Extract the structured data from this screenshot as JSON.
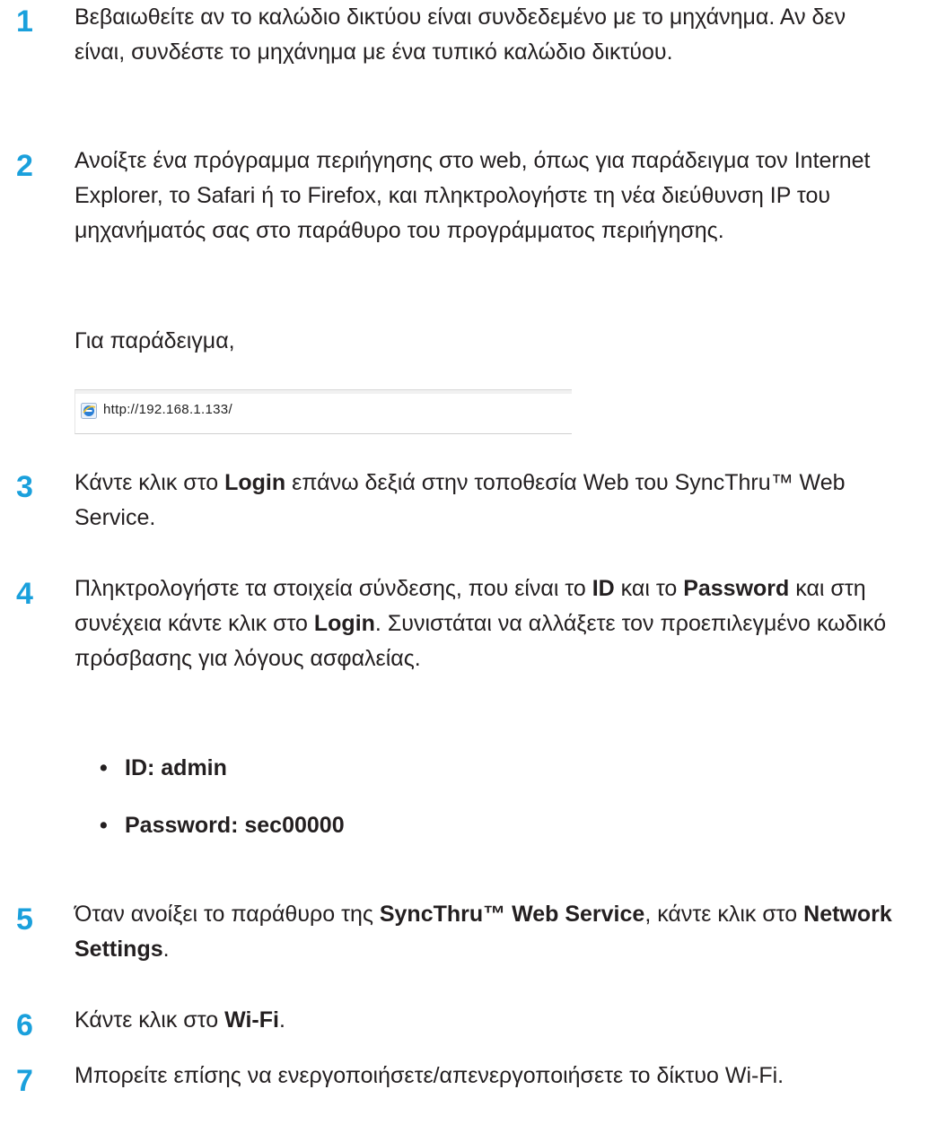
{
  "steps": [
    {
      "num": "1",
      "parts": [
        {
          "t": "Βεβαιωθείτε αν το καλώδιο δικτύου είναι συνδεδεμένο με το μηχάνημα. Αν δεν είναι, συνδέστε το μηχάνημα με ένα τυπικό καλώδιο δικτύου."
        }
      ]
    },
    {
      "num": "2",
      "parts": [
        {
          "t": "Ανοίξτε ένα πρόγραμμα περιήγησης στο web, όπως για παράδειγμα τον Internet Explorer, το Safari ή το Firefox, και πληκτρολογήστε τη νέα διεύθυνση IP του μηχανήματός σας στο παράθυρο του προγράμματος περιήγησης."
        }
      ],
      "example_label": "Για παράδειγμα,",
      "url": "http://192.168.1.133/"
    },
    {
      "num": "3",
      "parts": [
        {
          "t": "Κάντε κλικ στο "
        },
        {
          "b": "Login"
        },
        {
          "t": " επάνω δεξιά στην τοποθεσία Web του SyncThru™ Web Service."
        }
      ]
    },
    {
      "num": "4",
      "parts": [
        {
          "t": "Πληκτρολογήστε τα στοιχεία σύνδεσης, που είναι το "
        },
        {
          "b": "ID"
        },
        {
          "t": " και το "
        },
        {
          "b": "Password"
        },
        {
          "t": " και στη συνέχεια κάντε κλικ στο "
        },
        {
          "b": "Login"
        },
        {
          "t": ". Συνιστάται να αλλάξετε τον προεπιλεγμένο κωδικό πρόσβασης για λόγους ασφαλείας."
        }
      ],
      "bullets": [
        "ID: admin",
        "Password: sec00000"
      ]
    },
    {
      "num": "5",
      "parts": [
        {
          "t": "Όταν ανοίξει το παράθυρο της "
        },
        {
          "b": "SyncThru™ Web Service"
        },
        {
          "t": ", κάντε κλικ στο "
        },
        {
          "b": "Network Settings"
        },
        {
          "t": "."
        }
      ]
    },
    {
      "num": "6",
      "parts": [
        {
          "t": "Κάντε κλικ στο "
        },
        {
          "b": "Wi-Fi"
        },
        {
          "t": "."
        }
      ]
    },
    {
      "num": "7",
      "parts": [
        {
          "t": "Μπορείτε επίσης να ενεργοποιήσετε/απενεργοποιήσετε το δίκτυο Wi-Fi."
        }
      ]
    }
  ],
  "colors": {
    "step_number": "#1aa0dc",
    "text": "#231f20"
  },
  "icons": {
    "browser": "internet-explorer-icon"
  }
}
